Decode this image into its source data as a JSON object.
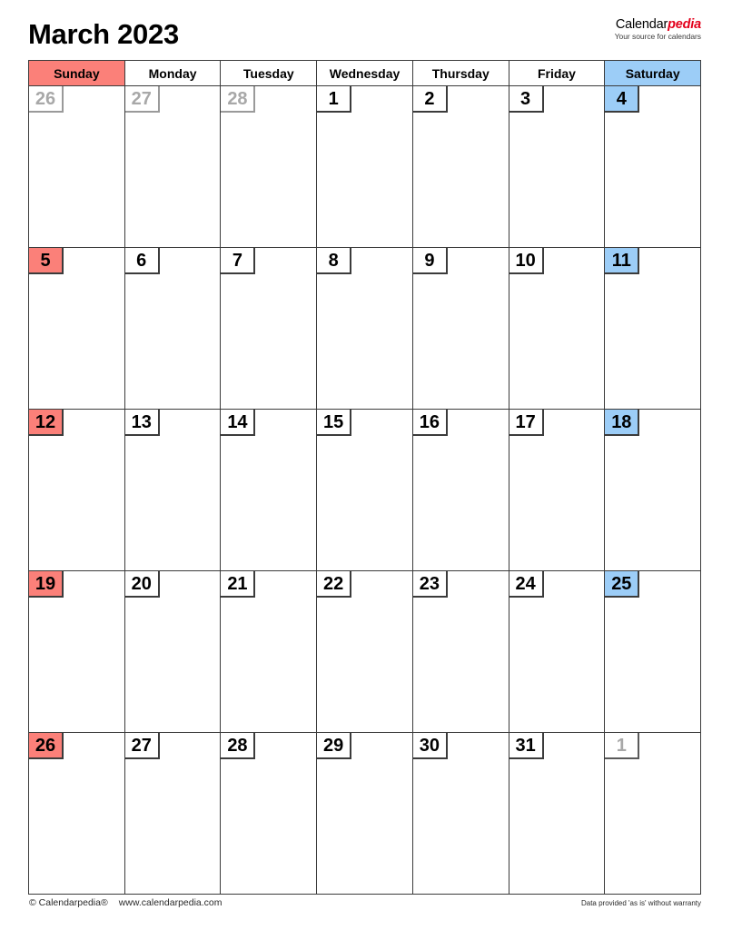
{
  "header": {
    "title": "March 2023",
    "brand_name_plain": "Calendar",
    "brand_name_accent": "pedia",
    "brand_tagline": "Your source for calendars",
    "accent_color": "#e3001b"
  },
  "calendar": {
    "month": "March",
    "year": "2023",
    "weekday_headers": [
      {
        "label": "Sunday",
        "kind": "sunday"
      },
      {
        "label": "Monday",
        "kind": "weekday"
      },
      {
        "label": "Tuesday",
        "kind": "weekday"
      },
      {
        "label": "Wednesday",
        "kind": "weekday"
      },
      {
        "label": "Thursday",
        "kind": "weekday"
      },
      {
        "label": "Friday",
        "kind": "weekday"
      },
      {
        "label": "Saturday",
        "kind": "saturday"
      }
    ],
    "sunday_color": "#fb8079",
    "saturday_color": "#9ccdf7",
    "outside_month_color": "#a8a8a8",
    "weeks": [
      [
        {
          "day": "26",
          "state": "prev"
        },
        {
          "day": "27",
          "state": "prev"
        },
        {
          "day": "28",
          "state": "prev"
        },
        {
          "day": "1",
          "state": "current"
        },
        {
          "day": "2",
          "state": "current"
        },
        {
          "day": "3",
          "state": "current"
        },
        {
          "day": "4",
          "state": "current-sat"
        }
      ],
      [
        {
          "day": "5",
          "state": "current-sun"
        },
        {
          "day": "6",
          "state": "current"
        },
        {
          "day": "7",
          "state": "current"
        },
        {
          "day": "8",
          "state": "current"
        },
        {
          "day": "9",
          "state": "current"
        },
        {
          "day": "10",
          "state": "current"
        },
        {
          "day": "11",
          "state": "current-sat"
        }
      ],
      [
        {
          "day": "12",
          "state": "current-sun"
        },
        {
          "day": "13",
          "state": "current"
        },
        {
          "day": "14",
          "state": "current"
        },
        {
          "day": "15",
          "state": "current"
        },
        {
          "day": "16",
          "state": "current"
        },
        {
          "day": "17",
          "state": "current"
        },
        {
          "day": "18",
          "state": "current-sat"
        }
      ],
      [
        {
          "day": "19",
          "state": "current-sun"
        },
        {
          "day": "20",
          "state": "current"
        },
        {
          "day": "21",
          "state": "current"
        },
        {
          "day": "22",
          "state": "current"
        },
        {
          "day": "23",
          "state": "current"
        },
        {
          "day": "24",
          "state": "current"
        },
        {
          "day": "25",
          "state": "current-sat"
        }
      ],
      [
        {
          "day": "26",
          "state": "current-sun"
        },
        {
          "day": "27",
          "state": "current"
        },
        {
          "day": "28",
          "state": "current"
        },
        {
          "day": "29",
          "state": "current"
        },
        {
          "day": "30",
          "state": "current"
        },
        {
          "day": "31",
          "state": "current"
        },
        {
          "day": "1",
          "state": "next"
        }
      ]
    ]
  },
  "footer": {
    "copyright": "© Calendarpedia®",
    "website": "www.calendarpedia.com",
    "disclaimer": "Data provided 'as is' without warranty"
  }
}
